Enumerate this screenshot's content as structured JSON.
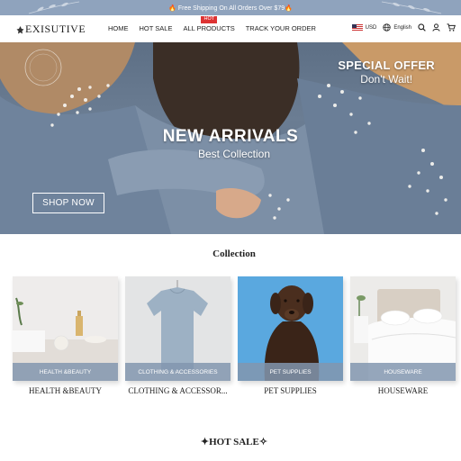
{
  "announcement": {
    "text": "🔥 Free Shipping On All Orders Over $79🔥"
  },
  "header": {
    "logo_text": "EXISUTIVE",
    "nav": [
      {
        "label": "HOME"
      },
      {
        "label": "HOT SALE"
      },
      {
        "label": "ALL PRODUCTS",
        "badge": "HOT"
      },
      {
        "label": "TRACK YOUR ORDER"
      }
    ],
    "currency": "USD",
    "language": "English",
    "icons": [
      "us-flag-icon",
      "globe-icon",
      "search-icon",
      "account-icon",
      "cart-icon"
    ]
  },
  "hero": {
    "title": "NEW ARRIVALS",
    "subtitle": "Best Collection",
    "offer_title": "SPECIAL OFFER",
    "offer_subtitle": "Don't Wait!",
    "cta": "SHOP NOW"
  },
  "collection": {
    "title": "Collection",
    "items": [
      {
        "band": "HEALTH &BEAUTY",
        "caption": "HEALTH &BEAUTY"
      },
      {
        "band": "CLOTHING & ACCESSORIES",
        "caption": "CLOTHING & ACCESSOR..."
      },
      {
        "band": "PET SUPPLIES",
        "caption": "PET SUPPLIES"
      },
      {
        "band": "HOUSEWARE",
        "caption": "HOUSEWARE"
      }
    ]
  },
  "hot_sale": {
    "title": "✦HOT SALE✧"
  },
  "colors": {
    "announcement_bg": "#8fa3bd",
    "badge": "#d33333",
    "band": "#8296af"
  }
}
